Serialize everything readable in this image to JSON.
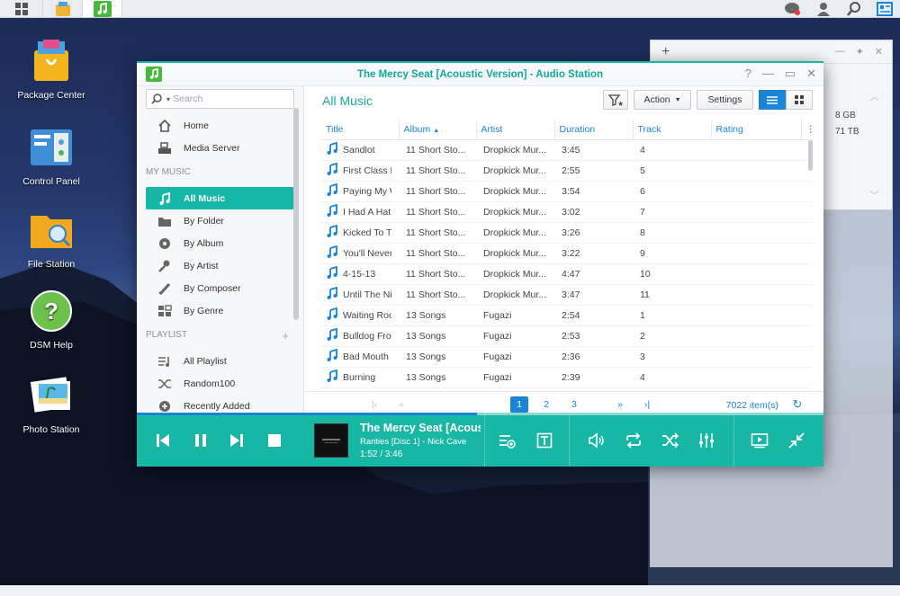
{
  "desktop": {
    "icons": [
      {
        "label": "Package Center"
      },
      {
        "label": "Control Panel"
      },
      {
        "label": "File Station"
      },
      {
        "label": "DSM Help"
      },
      {
        "label": "Photo Station"
      }
    ],
    "bg_window": {
      "plus": "+",
      "size1": "8 GB",
      "size2": "71 TB"
    }
  },
  "window": {
    "title": "The Mercy Seat [Acoustic Version] - Audio Station",
    "accent": "#16b7a6"
  },
  "sidebar": {
    "search_placeholder": "Search",
    "top_items": [
      {
        "label": "Home",
        "icon": "home-icon"
      },
      {
        "label": "Media Server",
        "icon": "media-server-icon"
      }
    ],
    "my_music_label": "MY MUSIC",
    "music_items": [
      {
        "label": "All Music",
        "icon": "music-note-icon",
        "active": true
      },
      {
        "label": "By Folder",
        "icon": "folder-icon"
      },
      {
        "label": "By Album",
        "icon": "album-icon"
      },
      {
        "label": "By Artist",
        "icon": "artist-icon"
      },
      {
        "label": "By Composer",
        "icon": "composer-icon"
      },
      {
        "label": "By Genre",
        "icon": "genre-icon"
      }
    ],
    "playlist_label": "PLAYLIST",
    "playlist_items": [
      {
        "label": "All Playlist",
        "icon": "playlist-icon"
      },
      {
        "label": "Random100",
        "icon": "shuffle-icon"
      },
      {
        "label": "Recently Added",
        "icon": "plus-circle-icon"
      }
    ]
  },
  "content": {
    "title": "All Music",
    "action_label": "Action",
    "settings_label": "Settings",
    "columns": [
      "Title",
      "Album",
      "Artist",
      "Duration",
      "Track",
      "Rating"
    ],
    "sort_indicator": "▲",
    "rows": [
      {
        "title": "Sandlot",
        "album": "11 Short Sto...",
        "artist": "Dropkick Mur...",
        "duration": "3:45",
        "track": "4"
      },
      {
        "title": "First Class L",
        "album": "11 Short Sto...",
        "artist": "Dropkick Mur...",
        "duration": "2:55",
        "track": "5"
      },
      {
        "title": "Paying My W",
        "album": "11 Short Sto...",
        "artist": "Dropkick Mur...",
        "duration": "3:54",
        "track": "6"
      },
      {
        "title": "I Had A Hat",
        "album": "11 Short Sto...",
        "artist": "Dropkick Mur...",
        "duration": "3:02",
        "track": "7"
      },
      {
        "title": "Kicked To Th",
        "album": "11 Short Sto...",
        "artist": "Dropkick Mur...",
        "duration": "3:26",
        "track": "8"
      },
      {
        "title": "You'll Never",
        "album": "11 Short Sto...",
        "artist": "Dropkick Mur...",
        "duration": "3:22",
        "track": "9"
      },
      {
        "title": "4-15-13",
        "album": "11 Short Sto...",
        "artist": "Dropkick Mur...",
        "duration": "4:47",
        "track": "10"
      },
      {
        "title": "Until The Ni",
        "album": "11 Short Sto...",
        "artist": "Dropkick Mur...",
        "duration": "3:47",
        "track": "11"
      },
      {
        "title": "Waiting Roo",
        "album": "13 Songs",
        "artist": "Fugazi",
        "duration": "2:54",
        "track": "1"
      },
      {
        "title": "Bulldog Fro",
        "album": "13 Songs",
        "artist": "Fugazi",
        "duration": "2:53",
        "track": "2"
      },
      {
        "title": "Bad Mouth",
        "album": "13 Songs",
        "artist": "Fugazi",
        "duration": "2:36",
        "track": "3"
      },
      {
        "title": "Burning",
        "album": "13 Songs",
        "artist": "Fugazi",
        "duration": "2:39",
        "track": "4"
      }
    ],
    "pager": {
      "pages": [
        "1",
        "2",
        "3"
      ],
      "current": "1",
      "count": "7022 item(s)"
    }
  },
  "player": {
    "title": "The Mercy Seat [Acoustic Version]",
    "subtitle": "Rarities [Disc 1] - Nick Cave",
    "time": "1:52 / 3:46",
    "progress": 0.495
  }
}
